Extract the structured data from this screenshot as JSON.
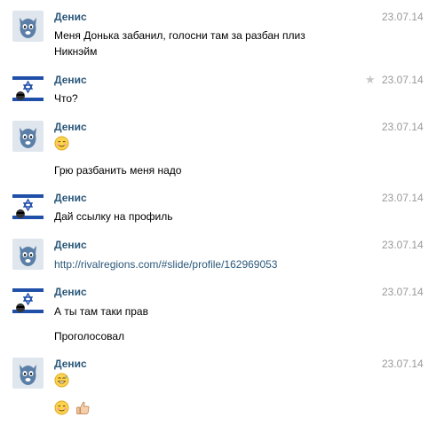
{
  "messages": [
    {
      "author": "Денис",
      "date": "23.07.14",
      "avatar": "dog-avatar",
      "lines": [
        "Меня Донька забанил, голосни там за разбан плиз",
        "Никнэйм"
      ]
    },
    {
      "author": "Денис",
      "date": "23.07.14",
      "avatar": "israel-flag-avatar",
      "starred": true,
      "lines": [
        "Что?"
      ]
    },
    {
      "author": "Денис",
      "date": "23.07.14",
      "avatar": "dog-avatar",
      "emoji_line": "relieved-face-emoji",
      "lines": [
        "Грю разбанить меня надо"
      ]
    },
    {
      "author": "Денис",
      "date": "23.07.14",
      "avatar": "israel-flag-avatar",
      "lines": [
        "Дай ссылку на профиль"
      ]
    },
    {
      "author": "Денис",
      "date": "23.07.14",
      "avatar": "dog-avatar",
      "link": "http://rivalregions.com/#slide/profile/162969053"
    },
    {
      "author": "Денис",
      "date": "23.07.14",
      "avatar": "israel-flag-avatar",
      "lines": [
        "А ты там таки прав",
        "Проголосовал"
      ]
    },
    {
      "author": "Денис",
      "date": "23.07.14",
      "avatar": "dog-avatar",
      "emojis": [
        "grinning-sweat-emoji",
        "relieved-face-emoji",
        "thumbs-up-emoji"
      ]
    }
  ],
  "colors": {
    "author": "#2b587a",
    "date": "#999999",
    "link": "#2b587a"
  }
}
